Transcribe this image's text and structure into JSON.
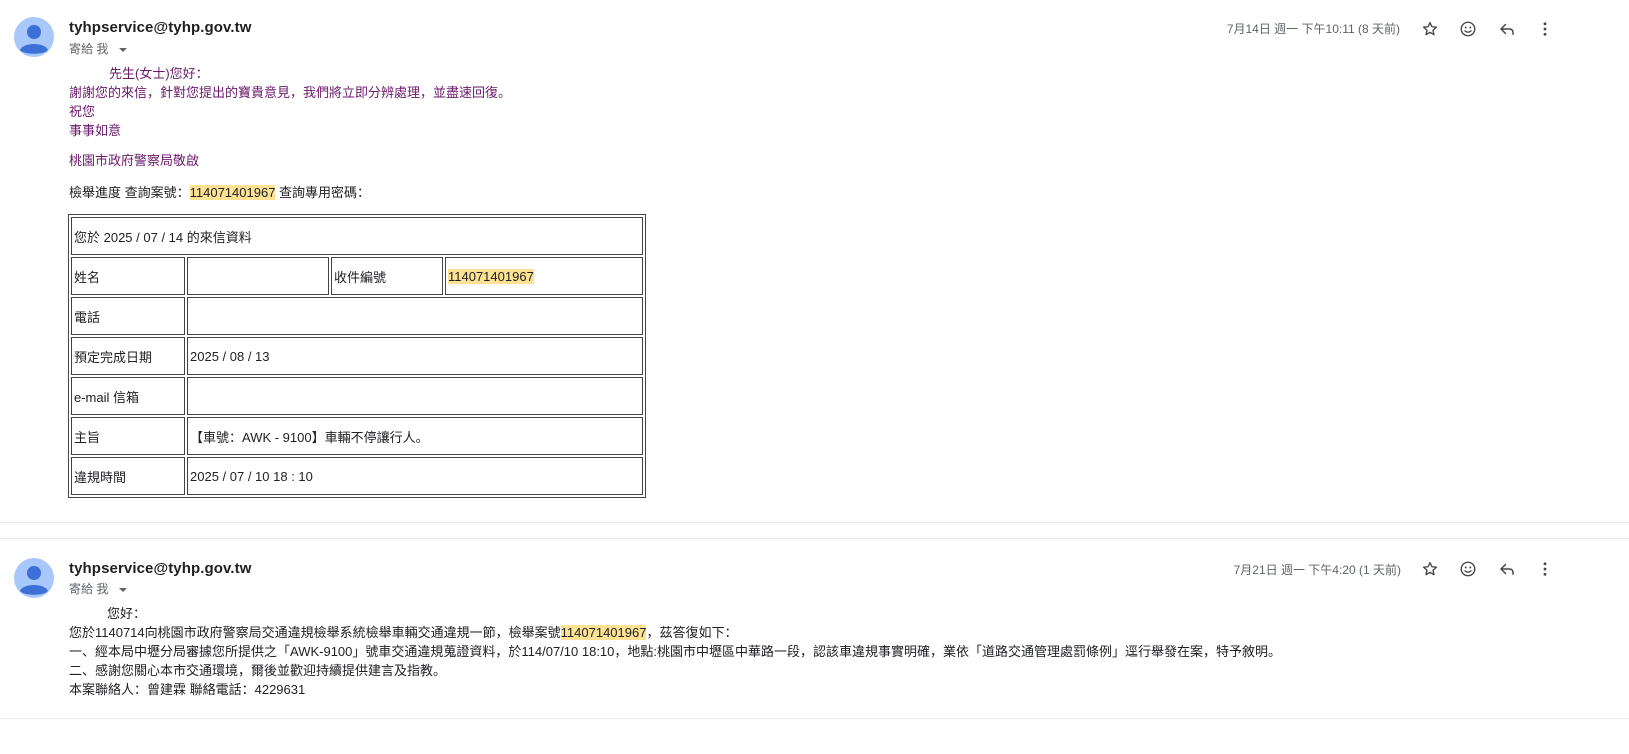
{
  "messages": [
    {
      "sender": "tyhpservice@tyhp.gov.tw",
      "to_me": "寄給 我",
      "date": "7月14日 週一 下午10:11 (8 天前)",
      "greeting": "先生(女士)您好：",
      "lines": [
        "謝謝您的來信，針對您提出的寶貴意見，我們將立即分辨處理，並盡速回復。",
        "祝您",
        "事事如意"
      ],
      "signoff": "桃園市政府警察局敬啟",
      "query": {
        "prefix": "檢舉進度 查詢案號：",
        "case_no": "114071401967",
        "suffix": " 查詢專用密碼："
      },
      "table": {
        "header": "您於 2025 / 07 / 14 的來信資料",
        "name_label": "姓名",
        "name_value": "",
        "receipt_label": "收件編號",
        "receipt_value": "114071401967",
        "phone_label": "電話",
        "phone_value": "",
        "due_label": "預定完成日期",
        "due_value": "2025 / 08 / 13",
        "email_label": "e-mail 信箱",
        "email_value": "",
        "subject_label": "主旨",
        "subject_value": "【車號：AWK - 9100】車輛不停讓行人。",
        "time_label": "違規時間",
        "time_value": "2025 / 07 / 10 18 : 10"
      }
    },
    {
      "sender": "tyhpservice@tyhp.gov.tw",
      "to_me": "寄給 我",
      "date": "7月21日 週一 下午4:20 (1 天前)",
      "greeting": "您好：",
      "line1_prefix": "您於1140714向桃園市政府警察局交通違規檢舉系統檢舉車輛交通違規一節，檢舉案號",
      "line1_case": "114071401967",
      "line1_suffix": "，茲答復如下：",
      "line2": "一、經本局中壢分局審據您所提供之「AWK-9100」號車交通違規蒐證資料，於114/07/10 18:10，地點:桃園市中壢區中華路一段，認該車違規事實明確，業依「道路交通管理處罰條例」逕行舉發在案，特予敘明。",
      "line3": "二、感謝您關心本市交通環境，爾後並歡迎持續提供建言及指教。",
      "line4": "本案聯絡人：曾建霖 聯絡電話：4229631"
    }
  ],
  "icons": {
    "star": "star-icon",
    "emoji": "emoji-icon",
    "reply": "reply-icon",
    "more": "more-vert-icon"
  },
  "colors": {
    "highlight": "#fde293",
    "purple_text": "#6b1a6b",
    "avatar": "#a8c7fa"
  }
}
